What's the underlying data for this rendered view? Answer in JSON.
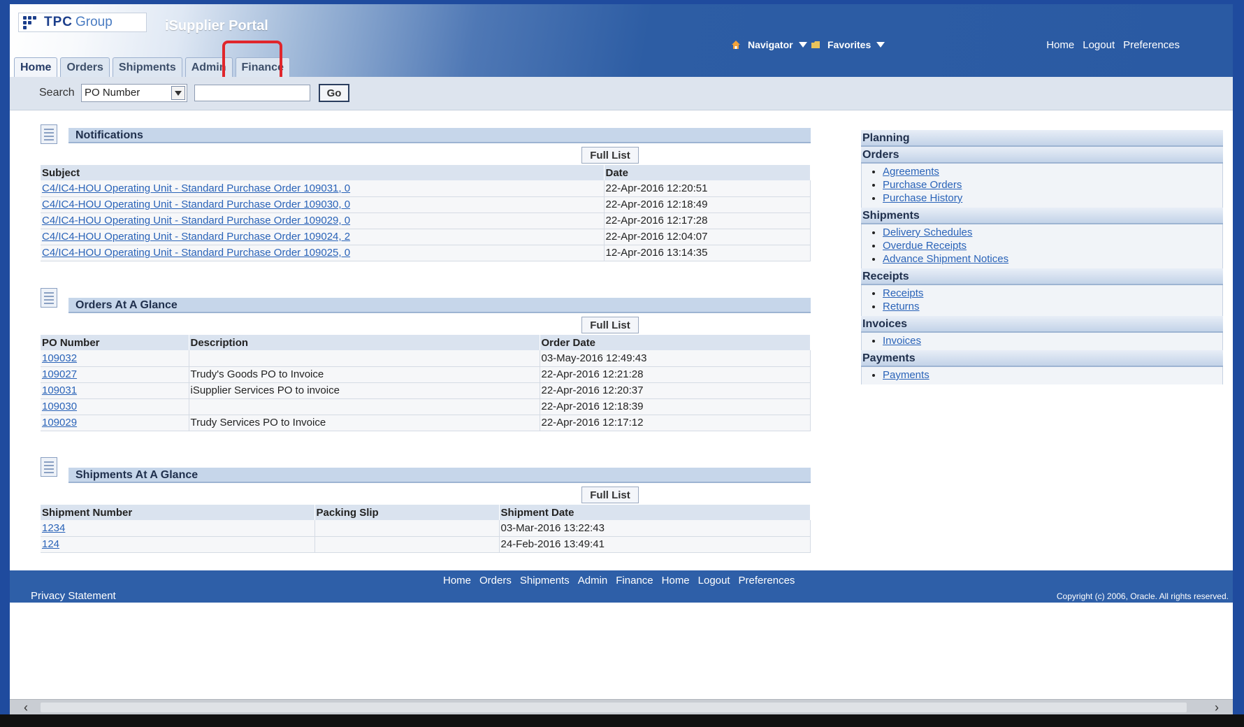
{
  "header": {
    "logo_word1": "TPC",
    "logo_word2": "Group",
    "portal_title": "iSupplier Portal",
    "navigator_label": "Navigator",
    "favorites_label": "Favorites",
    "global_links": [
      "Home",
      "Logout",
      "Preferences"
    ]
  },
  "tabs": [
    {
      "label": "Home",
      "active": true
    },
    {
      "label": "Orders",
      "active": false
    },
    {
      "label": "Shipments",
      "active": false
    },
    {
      "label": "Admin",
      "active": false
    },
    {
      "label": "Finance",
      "active": false
    }
  ],
  "highlight_color": "#e0262c",
  "search": {
    "label": "Search",
    "selected_option": "PO Number",
    "input_value": "",
    "go_label": "Go"
  },
  "notifications": {
    "title": "Notifications",
    "full_list_label": "Full List",
    "columns": [
      "Subject",
      "Date"
    ],
    "rows": [
      [
        "C4/IC4-HOU Operating Unit - Standard Purchase Order 109031, 0",
        "22-Apr-2016 12:20:51"
      ],
      [
        "C4/IC4-HOU Operating Unit - Standard Purchase Order 109030, 0",
        "22-Apr-2016 12:18:49"
      ],
      [
        "C4/IC4-HOU Operating Unit - Standard Purchase Order 109029, 0",
        "22-Apr-2016 12:17:28"
      ],
      [
        "C4/IC4-HOU Operating Unit - Standard Purchase Order 109024, 2",
        "22-Apr-2016 12:04:07"
      ],
      [
        "C4/IC4-HOU Operating Unit - Standard Purchase Order 109025, 0",
        "12-Apr-2016 13:14:35"
      ]
    ]
  },
  "orders": {
    "title": "Orders At A Glance",
    "full_list_label": "Full List",
    "columns": [
      "PO Number",
      "Description",
      "Order Date"
    ],
    "rows": [
      [
        "109032",
        "",
        "03-May-2016 12:49:43"
      ],
      [
        "109027",
        "Trudy's Goods PO to Invoice",
        "22-Apr-2016 12:21:28"
      ],
      [
        "109031",
        "iSupplier Services PO to invoice",
        "22-Apr-2016 12:20:37"
      ],
      [
        "109030",
        "",
        "22-Apr-2016 12:18:39"
      ],
      [
        "109029",
        "Trudy Services PO to Invoice",
        "22-Apr-2016 12:17:12"
      ]
    ]
  },
  "shipments": {
    "title": "Shipments At A Glance",
    "full_list_label": "Full List",
    "columns": [
      "Shipment Number",
      "Packing Slip",
      "Shipment Date"
    ],
    "rows": [
      [
        "1234",
        "",
        "03-Mar-2016 13:22:43"
      ],
      [
        "124",
        "",
        "24-Feb-2016 13:49:41"
      ]
    ]
  },
  "side_panel": {
    "planning": "Planning",
    "orders_head": "Orders",
    "orders_links": [
      "Agreements",
      "Purchase Orders",
      "Purchase History"
    ],
    "shipments_head": "Shipments",
    "shipments_links": [
      "Delivery Schedules",
      "Overdue Receipts",
      "Advance Shipment Notices"
    ],
    "receipts_head": "Receipts",
    "receipts_links": [
      "Receipts",
      "Returns"
    ],
    "invoices_head": "Invoices",
    "invoices_links": [
      "Invoices"
    ],
    "payments_head": "Payments",
    "payments_links": [
      "Payments"
    ]
  },
  "footer": {
    "links": [
      "Home",
      "Orders",
      "Shipments",
      "Admin",
      "Finance",
      "Home",
      "Logout",
      "Preferences"
    ],
    "privacy": "Privacy Statement",
    "copyright": "Copyright (c) 2006, Oracle. All rights reserved."
  }
}
